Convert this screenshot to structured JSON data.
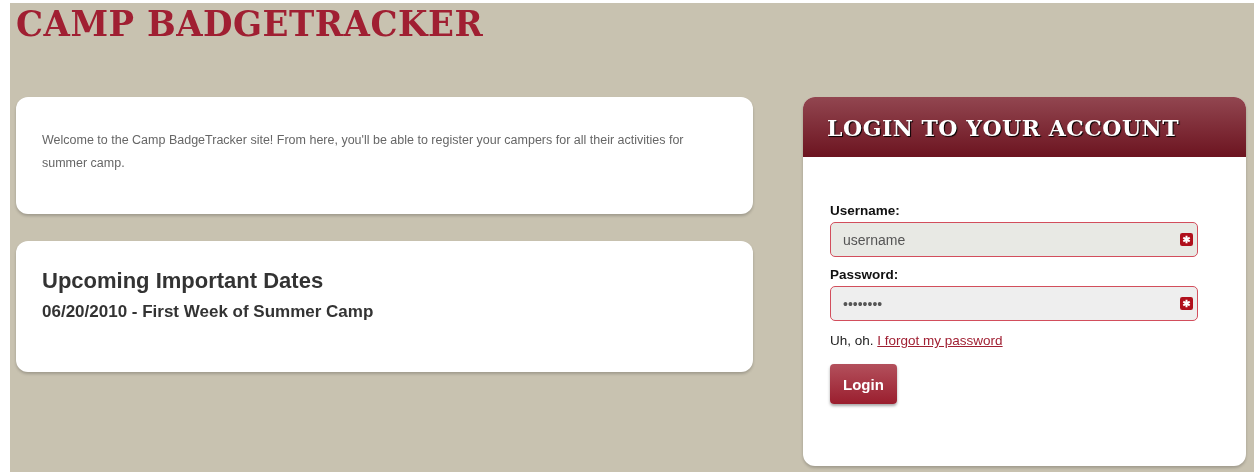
{
  "site_title": "CAMP BADGETRACKER",
  "welcome": {
    "text": "Welcome to the Camp BadgeTracker site! From here, you'll be able to register your campers for all their activities for summer camp."
  },
  "dates": {
    "heading": "Upcoming Important Dates",
    "items": [
      "06/20/2010 - First Week of Summer Camp"
    ]
  },
  "login": {
    "title": "LOGIN TO YOUR ACCOUNT",
    "fields": [
      {
        "label": "Username:",
        "value": "username",
        "required": true
      },
      {
        "label": "Password:",
        "value": "••••••••",
        "required": true
      }
    ],
    "forgot_prefix": "Uh, oh.",
    "forgot_link": "I forgot my password",
    "button": "Login"
  }
}
